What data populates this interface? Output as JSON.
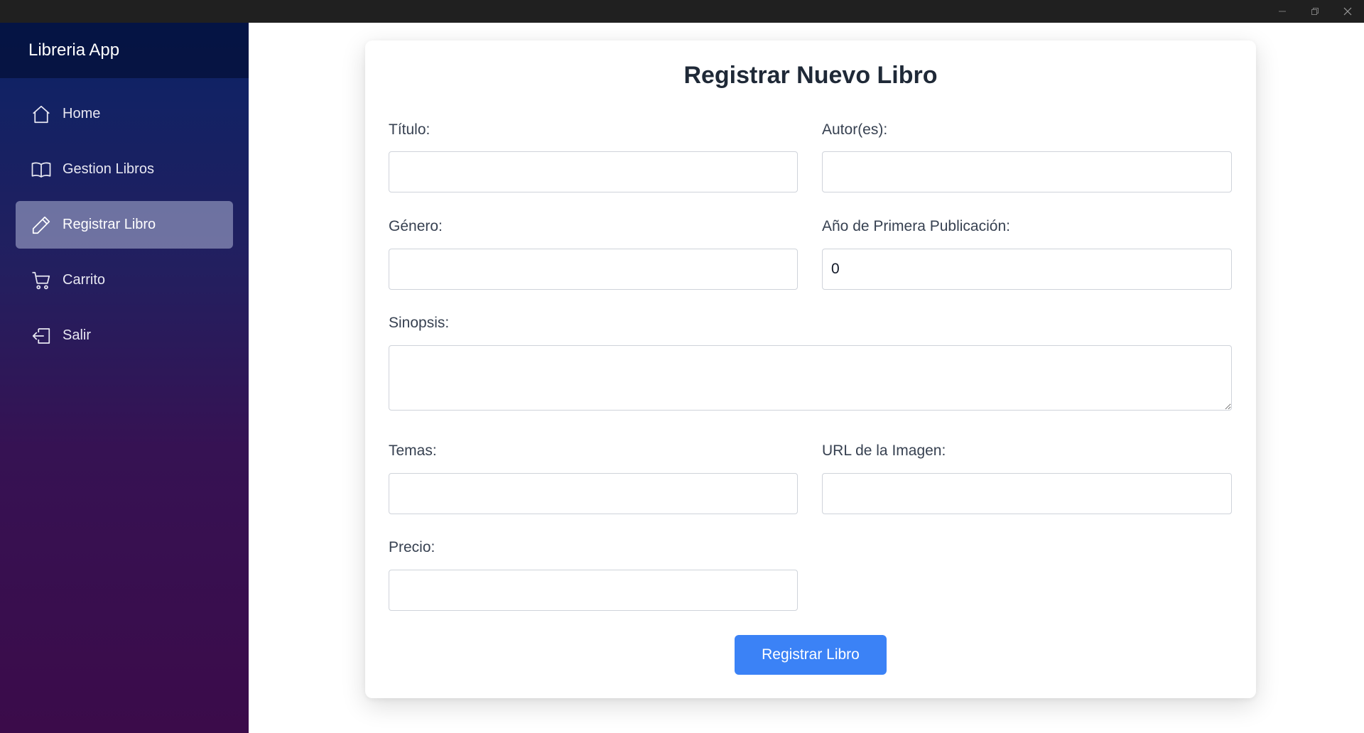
{
  "window": {
    "controls": {
      "minimize_icon": "minimize-icon",
      "maximize_icon": "restore-icon",
      "close_icon": "close-icon"
    }
  },
  "sidebar": {
    "brand": "Libreria App",
    "items": [
      {
        "label": "Home",
        "icon": "home-icon",
        "active": false
      },
      {
        "label": "Gestion Libros",
        "icon": "book-icon",
        "active": false
      },
      {
        "label": "Registrar Libro",
        "icon": "pencil-icon",
        "active": true
      },
      {
        "label": "Carrito",
        "icon": "cart-icon",
        "active": false
      },
      {
        "label": "Salir",
        "icon": "logout-icon",
        "active": false
      }
    ]
  },
  "form": {
    "title": "Registrar Nuevo Libro",
    "fields": {
      "titulo": {
        "label": "Título:",
        "value": ""
      },
      "autores": {
        "label": "Autor(es):",
        "value": ""
      },
      "genero": {
        "label": "Género:",
        "value": ""
      },
      "anio": {
        "label": "Año de Primera Publicación:",
        "value": "0"
      },
      "sinopsis": {
        "label": "Sinopsis:",
        "value": ""
      },
      "temas": {
        "label": "Temas:",
        "value": ""
      },
      "url_imagen": {
        "label": "URL de la Imagen:",
        "value": ""
      },
      "precio": {
        "label": "Precio:",
        "value": ""
      }
    },
    "submit_label": "Registrar Libro"
  },
  "colors": {
    "accent": "#3b82f6",
    "sidebar_top": "#0b2366",
    "sidebar_bottom": "#3b0b4a",
    "titlebar": "#202020"
  }
}
